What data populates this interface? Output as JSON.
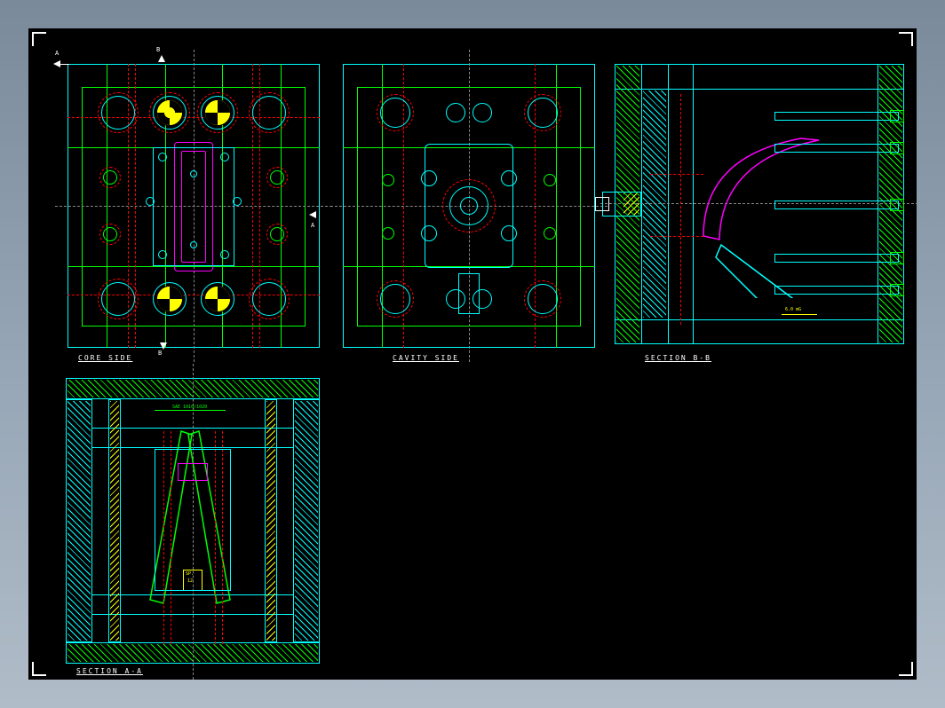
{
  "labels": {
    "core_side": "CORE SIDE",
    "cavity_side": "CAVITY SIDE",
    "section_bb": "SECTION B-B",
    "section_aa": "SECTION A-A",
    "tag_a": "A",
    "tag_b": "B",
    "sp": "SP.",
    "sp_num": "12"
  },
  "annotations": {
    "sae": "SAE 1010/1020"
  },
  "colors": {
    "bg": "#000000",
    "cyan": "#00ffff",
    "green": "#00ff00",
    "yellow": "#ffff00",
    "red": "#ff0000",
    "magenta": "#ff00ff",
    "white": "#ffffff"
  }
}
